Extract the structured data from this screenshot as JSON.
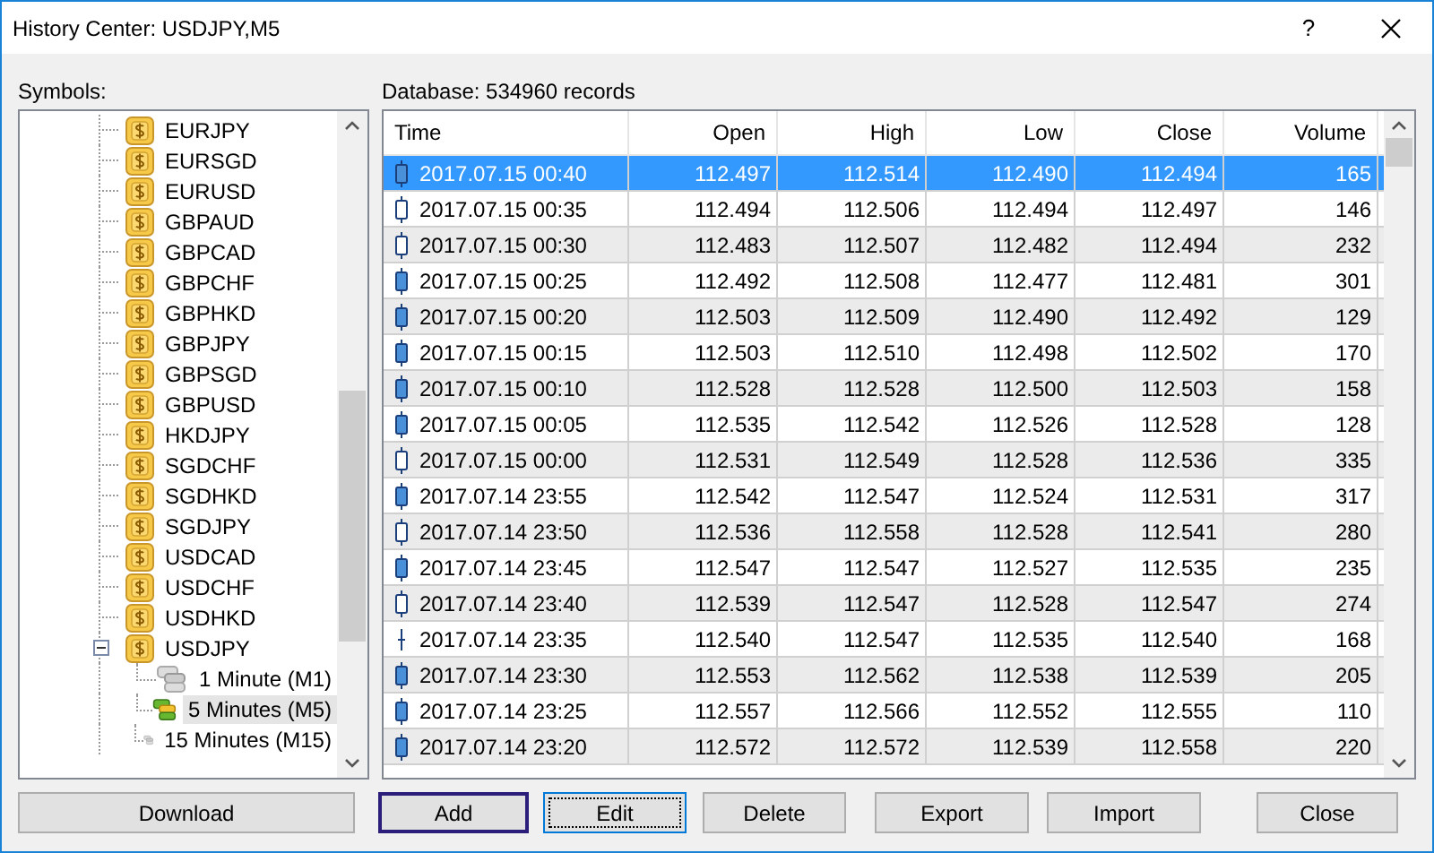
{
  "window": {
    "title": "History Center: USDJPY,M5",
    "help": "?"
  },
  "symbols": {
    "label": "Symbols:",
    "items": [
      {
        "label": "EURJPY"
      },
      {
        "label": "EURSGD"
      },
      {
        "label": "EURUSD"
      },
      {
        "label": "GBPAUD"
      },
      {
        "label": "GBPCAD"
      },
      {
        "label": "GBPCHF"
      },
      {
        "label": "GBPHKD"
      },
      {
        "label": "GBPJPY"
      },
      {
        "label": "GBPSGD"
      },
      {
        "label": "GBPUSD"
      },
      {
        "label": "HKDJPY"
      },
      {
        "label": "SGDCHF"
      },
      {
        "label": "SGDHKD"
      },
      {
        "label": "SGDJPY"
      },
      {
        "label": "USDCAD"
      },
      {
        "label": "USDCHF"
      },
      {
        "label": "USDHKD"
      },
      {
        "label": "USDJPY",
        "expanded": true,
        "children": [
          {
            "label": "1 Minute (M1)",
            "selected": false
          },
          {
            "label": "5 Minutes (M5)",
            "selected": true
          },
          {
            "label": "15 Minutes (M15)",
            "selected": false
          }
        ]
      }
    ]
  },
  "database": {
    "label": "Database: 534960 records"
  },
  "table": {
    "columns": [
      "Time",
      "Open",
      "High",
      "Low",
      "Close",
      "Volume"
    ],
    "rows": [
      {
        "kind": "bear",
        "selected": true,
        "cells": [
          "2017.07.15 00:40",
          "112.497",
          "112.514",
          "112.490",
          "112.494",
          "165"
        ]
      },
      {
        "kind": "bull",
        "selected": false,
        "cells": [
          "2017.07.15 00:35",
          "112.494",
          "112.506",
          "112.494",
          "112.497",
          "146"
        ]
      },
      {
        "kind": "bull",
        "selected": false,
        "cells": [
          "2017.07.15 00:30",
          "112.483",
          "112.507",
          "112.482",
          "112.494",
          "232"
        ]
      },
      {
        "kind": "bear",
        "selected": false,
        "cells": [
          "2017.07.15 00:25",
          "112.492",
          "112.508",
          "112.477",
          "112.481",
          "301"
        ]
      },
      {
        "kind": "bear",
        "selected": false,
        "cells": [
          "2017.07.15 00:20",
          "112.503",
          "112.509",
          "112.490",
          "112.492",
          "129"
        ]
      },
      {
        "kind": "bear",
        "selected": false,
        "cells": [
          "2017.07.15 00:15",
          "112.503",
          "112.510",
          "112.498",
          "112.502",
          "170"
        ]
      },
      {
        "kind": "bear",
        "selected": false,
        "cells": [
          "2017.07.15 00:10",
          "112.528",
          "112.528",
          "112.500",
          "112.503",
          "158"
        ]
      },
      {
        "kind": "bear",
        "selected": false,
        "cells": [
          "2017.07.15 00:05",
          "112.535",
          "112.542",
          "112.526",
          "112.528",
          "128"
        ]
      },
      {
        "kind": "bull",
        "selected": false,
        "cells": [
          "2017.07.15 00:00",
          "112.531",
          "112.549",
          "112.528",
          "112.536",
          "335"
        ]
      },
      {
        "kind": "bear",
        "selected": false,
        "cells": [
          "2017.07.14 23:55",
          "112.542",
          "112.547",
          "112.524",
          "112.531",
          "317"
        ]
      },
      {
        "kind": "bull",
        "selected": false,
        "cells": [
          "2017.07.14 23:50",
          "112.536",
          "112.558",
          "112.528",
          "112.541",
          "280"
        ]
      },
      {
        "kind": "bear",
        "selected": false,
        "cells": [
          "2017.07.14 23:45",
          "112.547",
          "112.547",
          "112.527",
          "112.535",
          "235"
        ]
      },
      {
        "kind": "bull",
        "selected": false,
        "cells": [
          "2017.07.14 23:40",
          "112.539",
          "112.547",
          "112.528",
          "112.547",
          "274"
        ]
      },
      {
        "kind": "doji",
        "selected": false,
        "cells": [
          "2017.07.14 23:35",
          "112.540",
          "112.547",
          "112.535",
          "112.540",
          "168"
        ]
      },
      {
        "kind": "bear",
        "selected": false,
        "cells": [
          "2017.07.14 23:30",
          "112.553",
          "112.562",
          "112.538",
          "112.539",
          "205"
        ]
      },
      {
        "kind": "bear",
        "selected": false,
        "cells": [
          "2017.07.14 23:25",
          "112.557",
          "112.566",
          "112.552",
          "112.555",
          "110"
        ]
      },
      {
        "kind": "bear",
        "selected": false,
        "cells": [
          "2017.07.14 23:20",
          "112.572",
          "112.572",
          "112.539",
          "112.558",
          "220"
        ]
      }
    ]
  },
  "buttons": [
    {
      "label": "Download",
      "kind": "plain"
    },
    {
      "label": "Add",
      "kind": "default"
    },
    {
      "label": "Edit",
      "kind": "focused"
    },
    {
      "label": "Delete",
      "kind": "plain"
    },
    {
      "label": "Export",
      "kind": "plain"
    },
    {
      "label": "Import",
      "kind": "plain"
    },
    {
      "label": "Close",
      "kind": "plain"
    }
  ]
}
